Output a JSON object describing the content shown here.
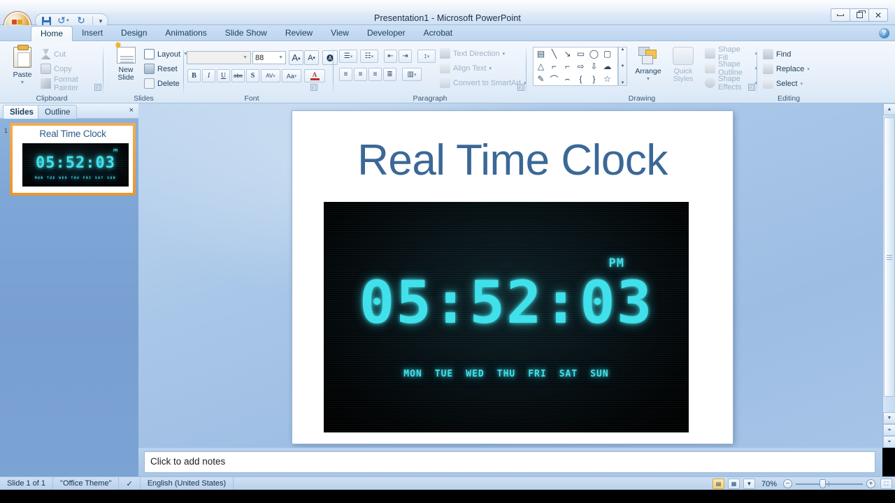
{
  "window": {
    "title": "Presentation1  -  Microsoft PowerPoint",
    "minimize_label": "Minimize",
    "restore_label": "Restore Down",
    "close_label": "Close",
    "help_label": "?"
  },
  "quick_access": {
    "save_label": "Save",
    "undo_label": "Undo",
    "redo_label": "Redo",
    "customize_label": "Customize Quick Access Toolbar"
  },
  "ribbon": {
    "tabs": [
      {
        "label": "Home",
        "active": true
      },
      {
        "label": "Insert",
        "active": false
      },
      {
        "label": "Design",
        "active": false
      },
      {
        "label": "Animations",
        "active": false
      },
      {
        "label": "Slide Show",
        "active": false
      },
      {
        "label": "Review",
        "active": false
      },
      {
        "label": "View",
        "active": false
      },
      {
        "label": "Developer",
        "active": false
      },
      {
        "label": "Acrobat",
        "active": false
      }
    ],
    "groups": {
      "clipboard": {
        "label": "Clipboard",
        "paste": "Paste",
        "cut": "Cut",
        "copy": "Copy",
        "format_painter": "Format Painter"
      },
      "slides": {
        "label": "Slides",
        "new_slide": "New\nSlide",
        "new_slide_line1": "New",
        "new_slide_line2": "Slide",
        "layout": "Layout",
        "reset": "Reset",
        "delete": "Delete"
      },
      "font": {
        "label": "Font",
        "font_name_value": "",
        "font_size_value": "88",
        "grow_font": "A",
        "shrink_font": "A",
        "clear_formatting": "Clear Formatting",
        "bold": "B",
        "italic": "I",
        "underline": "U",
        "strikethrough": "abc",
        "shadow": "S",
        "char_spacing": "AV",
        "change_case": "Aa",
        "font_color": "A"
      },
      "paragraph": {
        "label": "Paragraph",
        "text_direction": "Text Direction",
        "align_text": "Align Text",
        "convert_to_smartart": "Convert to SmartArt"
      },
      "drawing": {
        "label": "Drawing",
        "arrange": "Arrange",
        "quick_styles_line1": "Quick",
        "quick_styles_line2": "Styles",
        "shape_fill": "Shape Fill",
        "shape_outline": "Shape Outline",
        "shape_effects": "Shape Effects"
      },
      "editing": {
        "label": "Editing",
        "find": "Find",
        "replace": "Replace",
        "select": "Select"
      }
    }
  },
  "left_pane": {
    "tabs": [
      {
        "label": "Slides",
        "active": true
      },
      {
        "label": "Outline",
        "active": false
      }
    ],
    "close_label": "×",
    "thumbnail": {
      "number": "1",
      "title": "Real Time Clock"
    }
  },
  "slide": {
    "title": "Real Time Clock",
    "clock": {
      "time": "05:52:03",
      "meridiem": "PM",
      "days": [
        "MON",
        "TUE",
        "WED",
        "THU",
        "FRI",
        "SAT",
        "SUN"
      ],
      "digit_color": "#3ee0ea",
      "background_color": "#000000"
    },
    "title_color": "#3b6896"
  },
  "notes": {
    "placeholder": "Click to add notes"
  },
  "status_bar": {
    "slide_count": "Slide 1 of 1",
    "theme": "\"Office Theme\"",
    "language": "English (United States)",
    "spellcheck_label": "Spelling check",
    "zoom_value": "70%",
    "views": [
      {
        "name": "normal-view",
        "selected": true
      },
      {
        "name": "slide-sorter-view",
        "selected": false
      },
      {
        "name": "slide-show-view",
        "selected": false
      }
    ],
    "zoom_out_label": "−",
    "zoom_in_label": "+",
    "fit_label": "Fit slide to current window"
  }
}
